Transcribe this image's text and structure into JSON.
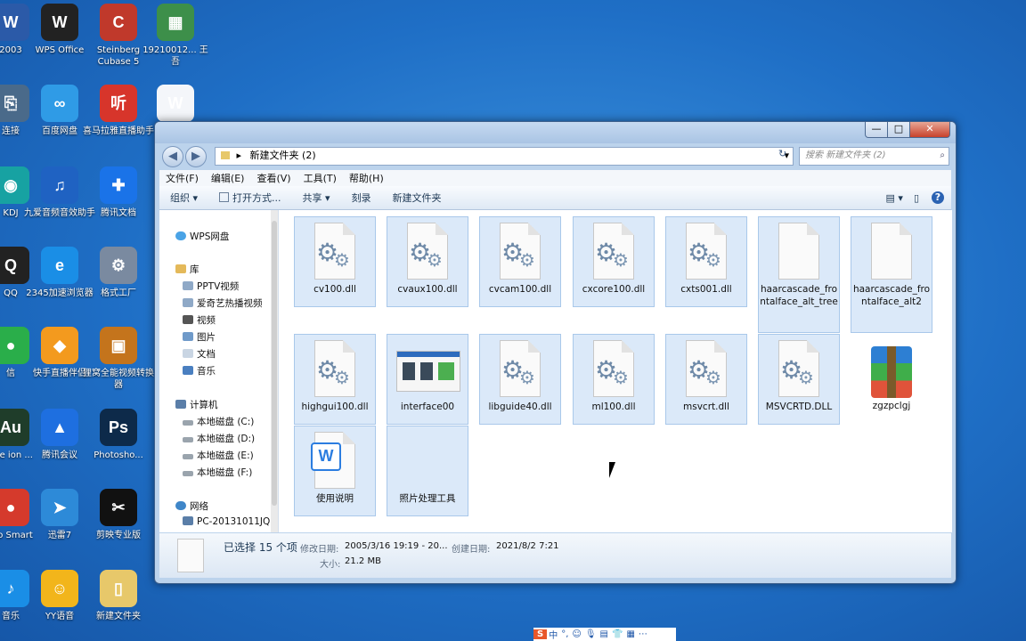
{
  "desktop": {
    "icons": [
      {
        "label": "2003",
        "glyph": "W",
        "color": "#2b5aa8"
      },
      {
        "label": "WPS Office",
        "glyph": "W",
        "color": "#222222"
      },
      {
        "label": "Steinberg Cubase 5",
        "glyph": "C",
        "color": "#c0392b"
      },
      {
        "label": "19210012... 王吾",
        "glyph": "▦",
        "color": "#3d8f4a"
      },
      {
        "label": "连接",
        "glyph": "⎘",
        "color": "#4a6a8a"
      },
      {
        "label": "百度网盘",
        "glyph": "∞",
        "color": "#2f9be6"
      },
      {
        "label": "喜马拉雅直播助手",
        "glyph": "听",
        "color": "#d7352b"
      },
      {
        "label": "",
        "glyph": "W",
        "color": "#f4f6fa"
      },
      {
        "label": "KDJ",
        "glyph": "◉",
        "color": "#17a2a2"
      },
      {
        "label": "九爱音频音效助手",
        "glyph": "♫",
        "color": "#1f62c2"
      },
      {
        "label": "腾讯文档",
        "glyph": "✚",
        "color": "#1a73e8"
      },
      {
        "label": "QQ",
        "glyph": "Q",
        "color": "#222222"
      },
      {
        "label": "2345加速浏览器",
        "glyph": "e",
        "color": "#1a8ee6"
      },
      {
        "label": "格式工厂",
        "glyph": "⚙",
        "color": "#7a8aa0"
      },
      {
        "label": "信",
        "glyph": "●",
        "color": "#2aae4a"
      },
      {
        "label": "快手直播伴侣",
        "glyph": "◆",
        "color": "#f39a1e"
      },
      {
        "label": "狸窝全能视频转换器",
        "glyph": "▣",
        "color": "#c4741c"
      },
      {
        "label": "obe ion ...",
        "glyph": "Au",
        "color": "#1f3d2a"
      },
      {
        "label": "腾讯会议",
        "glyph": "▲",
        "color": "#1e6fe0"
      },
      {
        "label": "Photosho...",
        "glyph": "Ps",
        "color": "#0d2a4a"
      },
      {
        "label": "ero Smart",
        "glyph": "●",
        "color": "#d53a2c"
      },
      {
        "label": "迅雷7",
        "glyph": "➤",
        "color": "#2d8ad8"
      },
      {
        "label": "剪映专业版",
        "glyph": "✂",
        "color": "#111111"
      },
      {
        "label": "音乐",
        "glyph": "♪",
        "color": "#1a8ee6"
      },
      {
        "label": "YY语音",
        "glyph": "☺",
        "color": "#f2b51b"
      },
      {
        "label": "新建文件夹",
        "glyph": "▯",
        "color": "#e7c86a"
      }
    ]
  },
  "window": {
    "controls": {
      "minimize": "—",
      "maximize": "□",
      "close": "✕"
    },
    "nav": {
      "back": "◀",
      "forward": "▶"
    },
    "address": {
      "path": "新建文件夹 (2)",
      "sep": "▸",
      "dropdown": "▾",
      "refresh": "↻"
    },
    "search": {
      "placeholder": "搜索 新建文件夹 (2)",
      "icon": "⌕"
    },
    "menu": [
      "文件(F)",
      "编辑(E)",
      "查看(V)",
      "工具(T)",
      "帮助(H)"
    ],
    "toolbar": {
      "organize": "组织 ▾",
      "open_with": "打开方式...",
      "share": "共享 ▾",
      "burn": "刻录",
      "new_folder": "新建文件夹",
      "help": "?"
    },
    "navpane": {
      "wps": "WPS网盘",
      "libraries": "库",
      "lib_items": [
        "PPTV视频",
        "爱奇艺热播视频",
        "视频",
        "图片",
        "文档",
        "音乐"
      ],
      "computer": "计算机",
      "drives": [
        "本地磁盘 (C:)",
        "本地磁盘 (D:)",
        "本地磁盘 (E:)",
        "本地磁盘 (F:)"
      ],
      "network": "网络",
      "network_items": [
        "PC-20131011JQ"
      ]
    },
    "files": [
      {
        "name": "cv100.dll",
        "type": "dll",
        "selected": true
      },
      {
        "name": "cvaux100.dll",
        "type": "dll",
        "selected": true
      },
      {
        "name": "cvcam100.dll",
        "type": "dll",
        "selected": true
      },
      {
        "name": "cxcore100.dll",
        "type": "dll",
        "selected": true
      },
      {
        "name": "cxts001.dll",
        "type": "dll",
        "selected": true
      },
      {
        "name": "haarcascade_frontalface_alt_tree",
        "type": "blank",
        "selected": true
      },
      {
        "name": "haarcascade_frontalface_alt2",
        "type": "blank",
        "selected": true
      },
      {
        "name": "highgui100.dll",
        "type": "dll",
        "selected": true
      },
      {
        "name": "interface00",
        "type": "image",
        "selected": true
      },
      {
        "name": "libguide40.dll",
        "type": "dll",
        "selected": true
      },
      {
        "name": "ml100.dll",
        "type": "dll",
        "selected": true
      },
      {
        "name": "msvcrt.dll",
        "type": "dll",
        "selected": true
      },
      {
        "name": "MSVCRTD.DLL",
        "type": "dll",
        "selected": true
      },
      {
        "name": "zgzpclgj",
        "type": "archive",
        "selected": false
      },
      {
        "name": "使用说明",
        "type": "word",
        "selected": true
      },
      {
        "name": "照片处理工具",
        "type": "blankexe",
        "selected": true
      }
    ],
    "status": {
      "selected": "已选择 15 个项",
      "modified_label": "修改日期:",
      "modified": "2005/3/16 19:19 - 20...",
      "created_label": "创建日期:",
      "created": "2021/8/2 7:21",
      "size_label": "大小:",
      "size": "21.2 MB"
    }
  },
  "taskbar_tray": [
    "S",
    "中",
    "°,",
    "☺",
    "🎙",
    "▤",
    "👕",
    "▦",
    "⋯"
  ]
}
